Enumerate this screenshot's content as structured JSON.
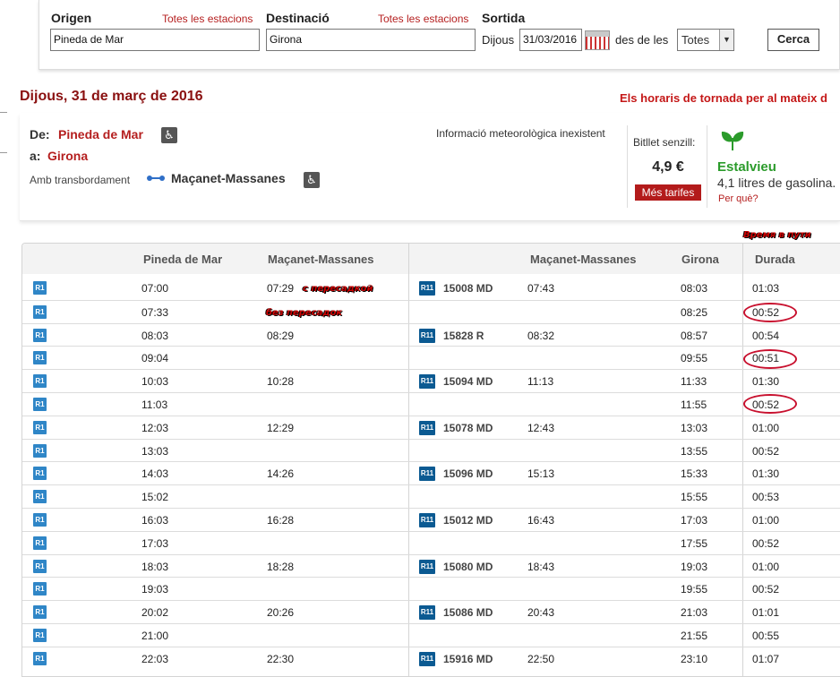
{
  "search": {
    "origin_label": "Origen",
    "origin_all_link": "Totes les estacions",
    "origin_value": "Pineda de Mar",
    "destination_label": "Destinació",
    "destination_all_link": "Totes les estacions",
    "destination_value": "Girona",
    "departure_label": "Sortida",
    "day_name": "Dijous",
    "date_value": "31/03/2016",
    "from_label": "des de les",
    "time_select": "Totes",
    "search_button": "Cerca"
  },
  "header": {
    "date_title": "Dijous, 31 de març de 2016",
    "return_link": "Els horaris de tornada per al mateix d"
  },
  "route": {
    "from_label": "De:",
    "from_station": "Pineda de Mar",
    "to_label": "a:",
    "to_station": "Girona",
    "transfer_label": "Amb transbordament",
    "transfer_station": "Maçanet-Massanes",
    "weather": "Informació meteorològica inexistent",
    "ticket_label": "Bitllet senzill:",
    "ticket_price": "4,9 €",
    "more_fares": "Més tarifes",
    "eco_title": "Estalvieu",
    "eco_subtitle": "4,1 litres de gasolina.",
    "eco_link": "Per què?",
    "wheelchair_glyph": "♿"
  },
  "table": {
    "headers": {
      "origin": "Pineda de Mar",
      "transfer_arrive": "Maçanet-Massanes",
      "transfer_depart": "Maçanet-Massanes",
      "destination": "Girona",
      "duration": "Durada"
    },
    "line_badge": "R1",
    "transfer_badge": "R11",
    "rows": [
      {
        "dep": "07:00",
        "arr_transfer": "07:29",
        "train": "15008 MD",
        "dep_transfer": "07:43",
        "arr": "08:03",
        "dur": "01:03"
      },
      {
        "dep": "07:33",
        "arr_transfer": "",
        "train": "",
        "dep_transfer": "",
        "arr": "08:25",
        "dur": "00:52"
      },
      {
        "dep": "08:03",
        "arr_transfer": "08:29",
        "train": "15828 R",
        "dep_transfer": "08:32",
        "arr": "08:57",
        "dur": "00:54"
      },
      {
        "dep": "09:04",
        "arr_transfer": "",
        "train": "",
        "dep_transfer": "",
        "arr": "09:55",
        "dur": "00:51"
      },
      {
        "dep": "10:03",
        "arr_transfer": "10:28",
        "train": "15094 MD",
        "dep_transfer": "11:13",
        "arr": "11:33",
        "dur": "01:30"
      },
      {
        "dep": "11:03",
        "arr_transfer": "",
        "train": "",
        "dep_transfer": "",
        "arr": "11:55",
        "dur": "00:52"
      },
      {
        "dep": "12:03",
        "arr_transfer": "12:29",
        "train": "15078 MD",
        "dep_transfer": "12:43",
        "arr": "13:03",
        "dur": "01:00"
      },
      {
        "dep": "13:03",
        "arr_transfer": "",
        "train": "",
        "dep_transfer": "",
        "arr": "13:55",
        "dur": "00:52"
      },
      {
        "dep": "14:03",
        "arr_transfer": "14:26",
        "train": "15096 MD",
        "dep_transfer": "15:13",
        "arr": "15:33",
        "dur": "01:30"
      },
      {
        "dep": "15:02",
        "arr_transfer": "",
        "train": "",
        "dep_transfer": "",
        "arr": "15:55",
        "dur": "00:53"
      },
      {
        "dep": "16:03",
        "arr_transfer": "16:28",
        "train": "15012 MD",
        "dep_transfer": "16:43",
        "arr": "17:03",
        "dur": "01:00"
      },
      {
        "dep": "17:03",
        "arr_transfer": "",
        "train": "",
        "dep_transfer": "",
        "arr": "17:55",
        "dur": "00:52"
      },
      {
        "dep": "18:03",
        "arr_transfer": "18:28",
        "train": "15080 MD",
        "dep_transfer": "18:43",
        "arr": "19:03",
        "dur": "01:00"
      },
      {
        "dep": "19:03",
        "arr_transfer": "",
        "train": "",
        "dep_transfer": "",
        "arr": "19:55",
        "dur": "00:52"
      },
      {
        "dep": "20:02",
        "arr_transfer": "20:26",
        "train": "15086 MD",
        "dep_transfer": "20:43",
        "arr": "21:03",
        "dur": "01:01"
      },
      {
        "dep": "21:00",
        "arr_transfer": "",
        "train": "",
        "dep_transfer": "",
        "arr": "21:55",
        "dur": "00:55"
      },
      {
        "dep": "22:03",
        "arr_transfer": "22:30",
        "train": "15916 MD",
        "dep_transfer": "22:50",
        "arr": "23:10",
        "dur": "01:07"
      }
    ]
  },
  "annotations": {
    "travel_time": "Время в пути",
    "with_transfer": "с пересадкой",
    "no_transfer": "без пересадок",
    "highlight_color": "#c8102e"
  }
}
